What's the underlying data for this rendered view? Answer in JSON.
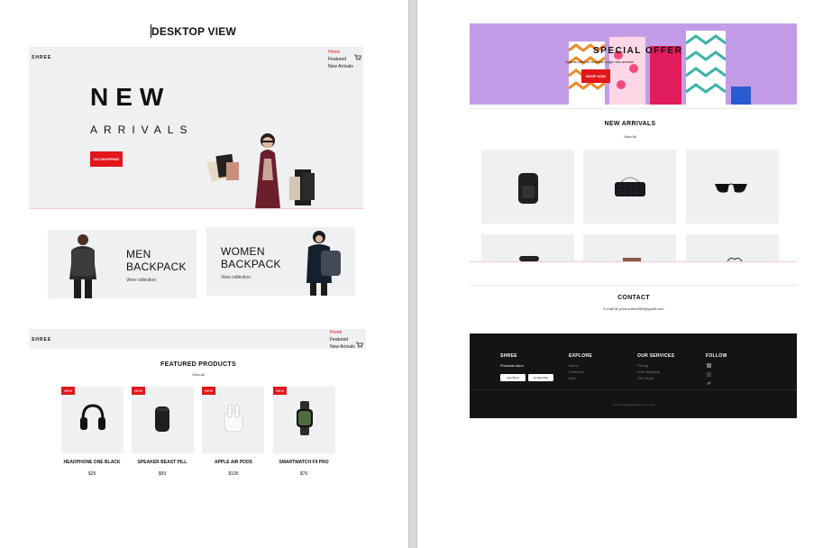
{
  "doc": {
    "title": "DESKTOP VIEW"
  },
  "hero": {
    "brand": "SHREE",
    "nav": [
      "Home",
      "Featured",
      "New Arrivals"
    ],
    "headline": "NEW",
    "subheadline": "ARRIVALS",
    "cta": "GO SHOPPING"
  },
  "backpacks": [
    {
      "title_line1": "MEN",
      "title_line2": "BACKPACK",
      "link": "View collection"
    },
    {
      "title_line1": "WOMEN",
      "title_line2": "BACKPACK",
      "link": "View collection"
    }
  ],
  "nav2": {
    "brand": "SHREE",
    "items": [
      "Home",
      "Featured",
      "New Arrivals"
    ]
  },
  "featured": {
    "title": "FEATURED PRODUCTS",
    "link": "View All",
    "badge": "NEW",
    "products": [
      {
        "name": "HEADPHONE ONE BLACK",
        "price": "$29"
      },
      {
        "name": "SPEAKER BEAST PILL",
        "price": "$59"
      },
      {
        "name": "APPLE AIR PODS",
        "price": "$105"
      },
      {
        "name": "SMARTWATCH F9 PRO",
        "price": "$79"
      }
    ]
  },
  "offer": {
    "title": "SPECIAL OFFER",
    "subtitle": "Special offer on branded bags new arrivals",
    "cta": "SHOP NOW"
  },
  "new_arrivals": {
    "title": "NEW ARRIVALS",
    "link": "View All"
  },
  "contact": {
    "title": "CONTACT",
    "email": "E-mail id: prerna.tibra360@gmail.com"
  },
  "footer": {
    "brand": "SHREE",
    "tagline": "Products store",
    "app_store": "App Store",
    "google_play": "Google Play",
    "explore_title": "EXPLORE",
    "explore": [
      "Home",
      "Featured",
      "New"
    ],
    "services_title": "OUR SERVICES",
    "services": [
      "Pricing",
      "Free Shipping",
      "Gift Cards"
    ],
    "follow_title": "FOLLOW",
    "copyright": "© 2022 copyright all rights reserved"
  },
  "colors": {
    "accent": "#e2161b",
    "panel": "#eef0f2",
    "footer": "#141414",
    "offer_bg": "#c39ce8"
  }
}
